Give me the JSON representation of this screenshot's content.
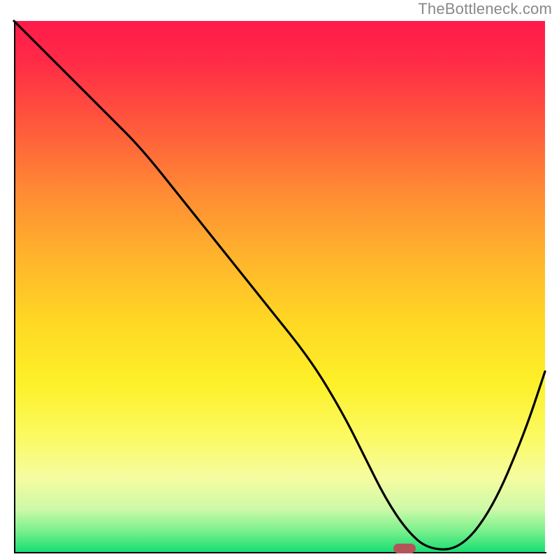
{
  "watermark": "TheBottleneck.com",
  "chart_data": {
    "type": "line",
    "title": "",
    "xlabel": "",
    "ylabel": "",
    "xlim": [
      0,
      100
    ],
    "ylim": [
      0,
      100
    ],
    "grid": false,
    "legend": false,
    "series": [
      {
        "name": "curve",
        "x": [
          0,
          8,
          18,
          24,
          32,
          40,
          48,
          56,
          62,
          66,
          70,
          74,
          78,
          84,
          90,
          96,
          100
        ],
        "y": [
          100,
          92,
          82,
          76,
          66,
          56,
          46,
          36,
          26,
          18,
          10,
          4,
          0.5,
          0.5,
          8,
          22,
          34
        ]
      }
    ],
    "marker": {
      "x": 73.5,
      "y": 0.6
    },
    "gradient_stops": [
      {
        "pct": 0,
        "color": "#ff1a4a"
      },
      {
        "pct": 20,
        "color": "#ff5a3c"
      },
      {
        "pct": 44,
        "color": "#ffb22c"
      },
      {
        "pct": 68,
        "color": "#fdf028"
      },
      {
        "pct": 86,
        "color": "#f6fca0"
      },
      {
        "pct": 96,
        "color": "#7af08c"
      },
      {
        "pct": 100,
        "color": "#18dd74"
      }
    ]
  }
}
